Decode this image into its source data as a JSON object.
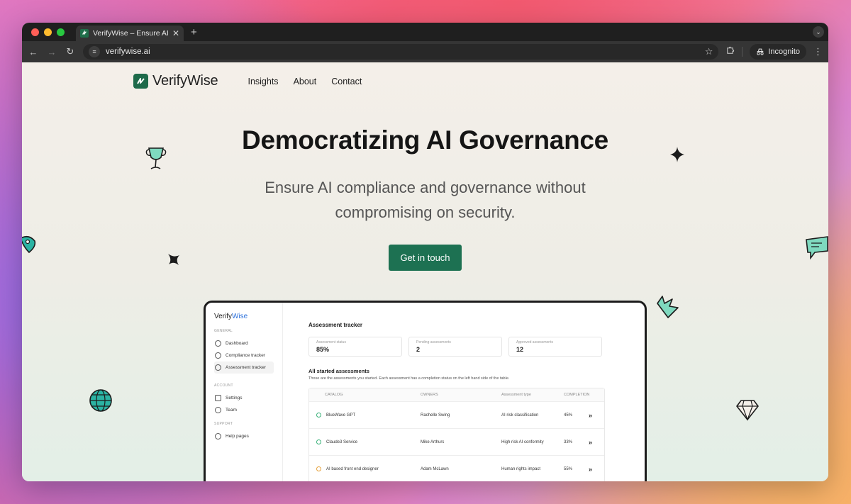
{
  "browser": {
    "tab_title": "VerifyWise – Ensure AI compl",
    "new_tab": "+",
    "url": "verifywise.ai",
    "incognito_label": "Incognito"
  },
  "site": {
    "brand": "VerifyWise",
    "nav": [
      "Insights",
      "About",
      "Contact"
    ],
    "hero_title": "Democratizing AI Governance",
    "hero_subtitle": "Ensure AI compliance and governance without compromising on security.",
    "cta_label": "Get in touch"
  },
  "mock": {
    "logo_a": "Verify",
    "logo_b": "Wise",
    "sections": {
      "general": "GENERAL",
      "account": "ACCOUNT",
      "support": "SUPPORT"
    },
    "nav": {
      "dashboard": "Dashboard",
      "compliance": "Compliance tracker",
      "assessment": "Assessment tracker",
      "settings": "Settings",
      "team": "Team",
      "help": "Help pages"
    },
    "header": "Assessment tracker",
    "stats": [
      {
        "label": "Assessment status",
        "value": "85%"
      },
      {
        "label": "Pending assessments",
        "value": "2"
      },
      {
        "label": "Approved assessments",
        "value": "12"
      }
    ],
    "section_title": "All started assessments",
    "section_desc": "Those are the assessments you started. Each assessment has a completion status on the left hand side of the table.",
    "columns": [
      "CATALOG",
      "OWNERS",
      "Assessment type",
      "COMPLETION"
    ],
    "rows": [
      {
        "catalog": "BlueWave GPT",
        "owner": "Rachelle Swing",
        "type": "AI risk classification",
        "completion": "45%"
      },
      {
        "catalog": "Claude3 Service",
        "owner": "Mike Arthurs",
        "type": "High risk AI conformity",
        "completion": "33%"
      },
      {
        "catalog": "AI based front end designer",
        "owner": "Adam McLawn",
        "type": "Human rights impact",
        "completion": "55%"
      }
    ],
    "row_action": "»"
  },
  "colors": {
    "brand_green": "#1d7152",
    "deco_teal": "#7fd9bf"
  }
}
